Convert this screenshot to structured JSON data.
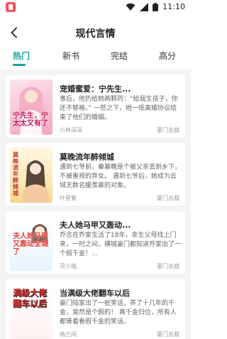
{
  "status": {
    "time": "11:10"
  },
  "header": {
    "title": "现代言情"
  },
  "tabs": [
    {
      "label": "热门",
      "active": true
    },
    {
      "label": "新书",
      "active": false
    },
    {
      "label": "完结",
      "active": false
    },
    {
      "label": "高分",
      "active": false
    }
  ],
  "books": [
    {
      "title": "宠婚蜜爱：宁先生...",
      "description": "事后，他扔给她两颗药：“给我生孩子，你还不够格。” 一怒之下，她一纸离婚协议结束了他们的婚姻。",
      "author": "小林深深",
      "tag": "豪门总裁",
      "cover_text": "宁先生，宁太太又有了"
    },
    {
      "title": "莫晚流年醉倾城",
      "description": "遇到七爷前，秦慕晚是个被父亲丢到乡下，不被重视的弃女。 遇到七爷后，她成为云城无数名媛羡慕的对象。",
      "author": "叶星繁",
      "tag": "豪门总裁",
      "cover_text": "莫晚流年醉倾城"
    },
    {
      "title": "夫人她马甲又轰动...",
      "description": "乔念在乔家生活了18年，亲生父母找上门来，一时之间，横城豪门都知道乔家出了一个假千金！...",
      "author": "灵小喵.",
      "tag": "豪门总裁",
      "cover_text": "夫人她马甲又轰动全城了"
    },
    {
      "title": "当满级大佬翻车以后",
      "description": "豪门陆家出了一桩笑话，养了十几年的千金，竟然是个假的！ 真千金归位，所有人都等着看假千金的笑话。",
      "author": "纳兰闲",
      "tag": "豪门总裁",
      "cover_text": "满级大佬翻车以后"
    }
  ]
}
